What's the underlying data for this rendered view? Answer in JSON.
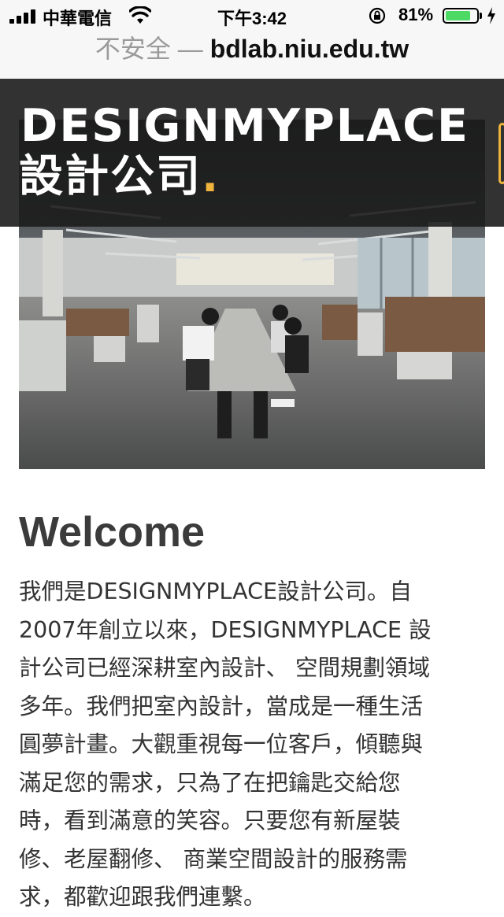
{
  "status_bar": {
    "carrier": "中華電信",
    "time": "下午3:42",
    "battery_percent": "81%",
    "battery_level": 0.81,
    "icons": [
      "signal-icon",
      "wifi-icon",
      "orientation-lock-icon",
      "battery-icon",
      "charging-icon"
    ]
  },
  "url_bar": {
    "insecure_label": "不安全 —",
    "domain": "bdlab.niu.edu.tw"
  },
  "header": {
    "brand_en": "DESIGNMYPLACE",
    "brand_zh": "設計公司",
    "brand_dot": ".",
    "accent_color": "#f0b43c"
  },
  "hero": {
    "icon": "office-photo"
  },
  "welcome": {
    "title": "Welcome",
    "lines": [
      "我們是DESIGNMYPLACE設計公司。自",
      "2007年創立以來，DESIGNMYPLACE 設",
      "計公司已經深耕室內設計、 空間規劃領域",
      "多年。我們把室內設計，當成是一種生活",
      "圓夢計畫。大觀重視每一位客戶，傾聽與",
      "滿足您的需求，只為了在把鑰匙交給您",
      "時，看到滿意的笑容。只要您有新屋裝",
      "修、老屋翻修、 商業空間設計的服務需",
      "求，都歡迎跟我們連繫。"
    ]
  }
}
